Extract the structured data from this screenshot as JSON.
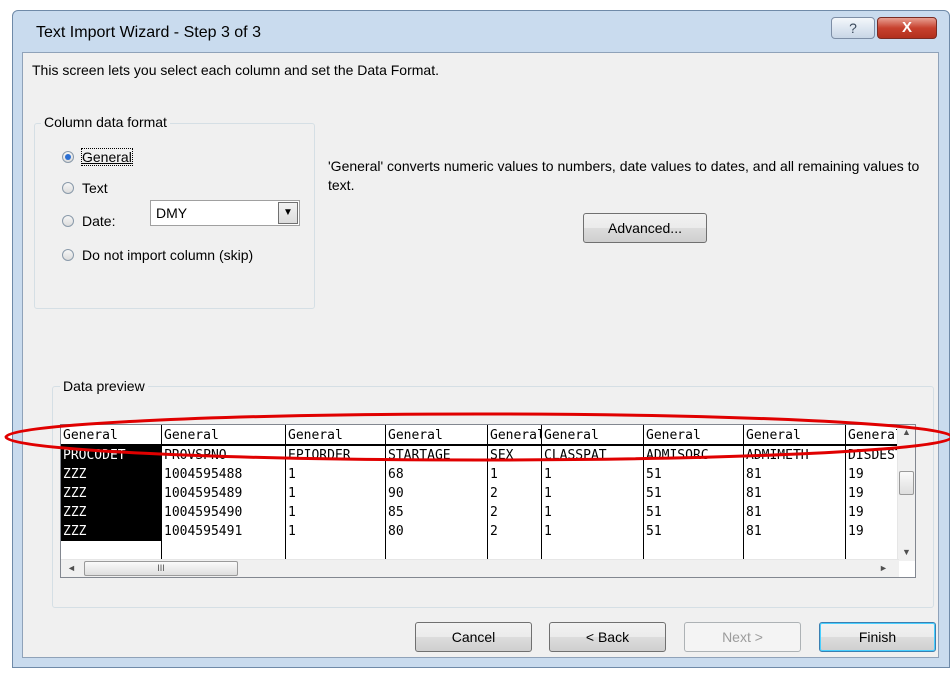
{
  "window": {
    "title": "Text Import Wizard - Step 3 of 3",
    "help_label": "?",
    "close_label": "X"
  },
  "intro_text": "This screen lets you select each column and set the Data Format.",
  "column_format": {
    "legend": "Column data format",
    "options": [
      "General",
      "Text",
      "Date:",
      "Do not import column (skip)"
    ],
    "selected": "General",
    "date_value": "DMY"
  },
  "description": "'General' converts numeric values to numbers, date values to dates, and all remaining values to text.",
  "advanced_label": "Advanced...",
  "preview": {
    "legend": "Data preview",
    "columns": [
      {
        "header": "General",
        "rows": [
          "PROCODET",
          "ZZZ",
          "ZZZ",
          "ZZZ",
          "ZZZ"
        ]
      },
      {
        "header": "General",
        "rows": [
          "PROVSPNO",
          "1004595488",
          "1004595489",
          "1004595490",
          "1004595491"
        ]
      },
      {
        "header": "General",
        "rows": [
          "EPIORDER",
          "1",
          "1",
          "1",
          "1"
        ]
      },
      {
        "header": "General",
        "rows": [
          "STARTAGE",
          "68",
          "90",
          "85",
          "80"
        ]
      },
      {
        "header": "General",
        "rows": [
          "SEX",
          "1",
          "2",
          "2",
          "2"
        ]
      },
      {
        "header": "General",
        "rows": [
          "CLASSPAT",
          "1",
          "1",
          "1",
          "1"
        ]
      },
      {
        "header": "General",
        "rows": [
          "ADMISORC",
          "51",
          "51",
          "51",
          "51"
        ]
      },
      {
        "header": "General",
        "rows": [
          "ADMIMETH",
          "81",
          "81",
          "81",
          "81"
        ]
      },
      {
        "header": "General",
        "rows": [
          "DISDEST",
          "19",
          "19",
          "19",
          "19"
        ]
      }
    ],
    "scroll_left": "◄",
    "scroll_right": "►",
    "scroll_up": "▲",
    "scroll_down": "▼",
    "thumb_grip": "III"
  },
  "buttons": {
    "cancel": "Cancel",
    "back": "< Back",
    "next": "Next >",
    "finish": "Finish"
  },
  "annotation": {
    "color": "#e00000",
    "shape": "ellipse"
  }
}
